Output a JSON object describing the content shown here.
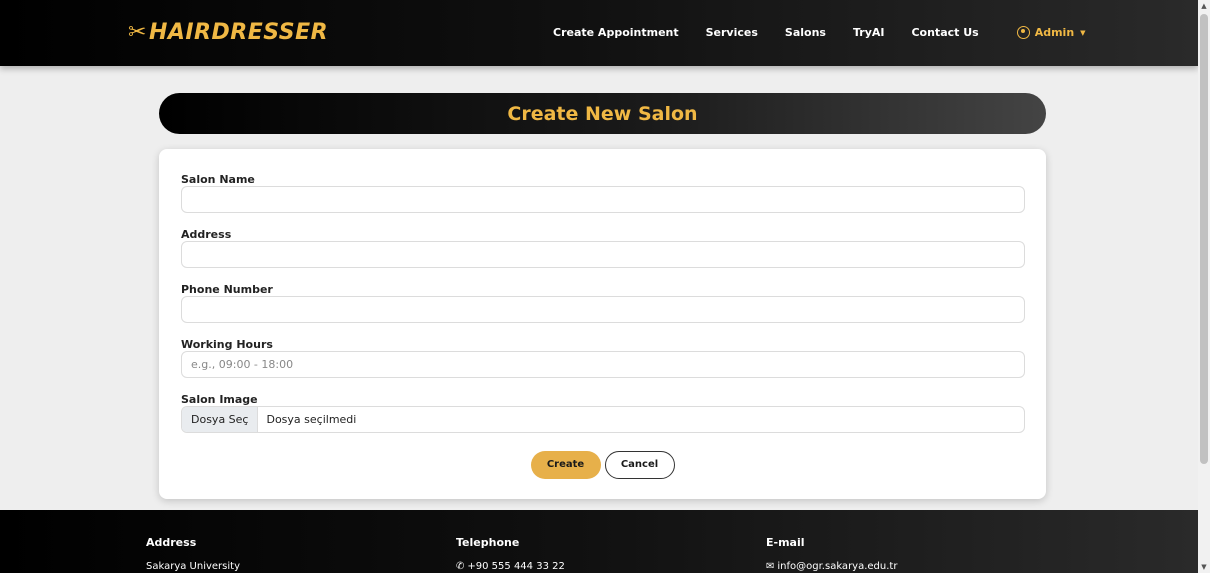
{
  "brand": {
    "name": "HAIRDRESSER",
    "icon": "scissors-icon",
    "color": "#f0b844"
  },
  "nav": {
    "links": [
      "Create Appointment",
      "Services",
      "Salons",
      "TryAI",
      "Contact Us"
    ],
    "user": "Admin"
  },
  "page": {
    "title": "Create New Salon"
  },
  "form": {
    "salon_name": {
      "label": "Salon Name",
      "value": "",
      "placeholder": ""
    },
    "address": {
      "label": "Address",
      "value": "",
      "placeholder": ""
    },
    "phone": {
      "label": "Phone Number",
      "value": "",
      "placeholder": ""
    },
    "working_hours": {
      "label": "Working Hours",
      "value": "",
      "placeholder": "e.g., 09:00 - 18:00"
    },
    "image": {
      "label": "Salon Image",
      "button": "Dosya Seç",
      "status": "Dosya seçilmedi"
    },
    "create_label": "Create",
    "cancel_label": "Cancel"
  },
  "footer": {
    "address": {
      "title": "Address",
      "text": "Sakarya University"
    },
    "telephone": {
      "title": "Telephone",
      "text": "+90 555 444 33 22",
      "icon": "phone-icon"
    },
    "email": {
      "title": "E-mail",
      "text": "info@ogr.sakarya.edu.tr",
      "icon": "envelope-icon"
    }
  },
  "colors": {
    "accent": "#f0b844",
    "button": "#e7b04a",
    "dark": "#000000"
  }
}
